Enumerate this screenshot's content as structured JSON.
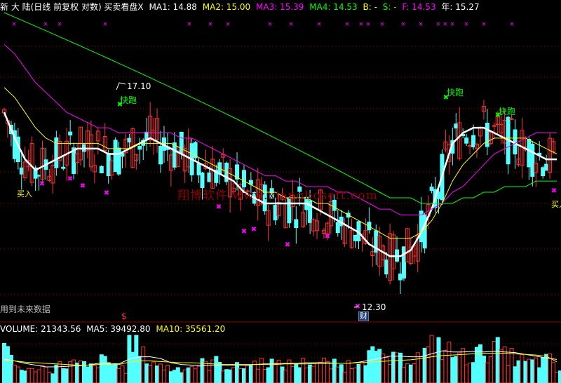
{
  "header": {
    "title": "新 大 陆(日线 前复权 对数) 买卖看盘X",
    "ma1": "MA1: 14.88",
    "ma2": "MA2: 15.00",
    "ma3": "MA3: 15.39",
    "ma4": "MA4: 14.53",
    "b": "B: -",
    "s": "S: -",
    "f": "F: 14.53",
    "year": "年: 15.27"
  },
  "volume_header": {
    "volume": "VOLUME: 21343.56",
    "ma5": "MA5: 39492.80",
    "ma10": "MA10: 35561.20"
  },
  "annotations": {
    "high_price": "17.10",
    "low_price": "12.30",
    "run_label": "快跑",
    "buy_label": "买入",
    "future_data": "用到未来数据",
    "dollar": "$",
    "cai": "财",
    "watermark": "翔博软件 www.xiangbosoft.com"
  },
  "colors": {
    "background": "#000000",
    "up_candle": "#ff3232",
    "down_candle": "#54ffff",
    "ma1": "#ffffff",
    "ma2": "#ffff00",
    "ma3": "#ff00ff",
    "ma4": "#00ff00",
    "grid": "#8b0000",
    "markers": "#ff00ff",
    "run_label": "#00ff00",
    "buy_label": "#ffff00"
  },
  "chart_data": [
    {
      "type": "candlestick",
      "scale": "log",
      "ylim": [
        12.2,
        17.9
      ],
      "series": [
        {
          "name": "MA1",
          "values": [
            15.8,
            15.3,
            14.9,
            14.7,
            14.8,
            14.9,
            15.0,
            15.1,
            15.1,
            15.1,
            15.0,
            15.0,
            15.1,
            15.2,
            15.3,
            15.2,
            15.1,
            15.0,
            14.9,
            14.8,
            14.7,
            14.6,
            14.5,
            14.3,
            14.2,
            14.1,
            14.1,
            14.1,
            14.1,
            14.1,
            14.0,
            13.9,
            13.8,
            13.7,
            13.6,
            13.4,
            13.3,
            13.2,
            13.2,
            13.3,
            13.6,
            14.0,
            14.6,
            15.2,
            15.4,
            15.5,
            15.5,
            15.4,
            15.3,
            15.2,
            15.1,
            15.0,
            14.9,
            14.9
          ]
        },
        {
          "name": "MA2",
          "values": [
            16.3,
            16.1,
            15.8,
            15.5,
            15.3,
            15.2,
            15.2,
            15.2,
            15.2,
            15.2,
            15.1,
            15.1,
            15.1,
            15.2,
            15.2,
            15.2,
            15.2,
            15.1,
            15.0,
            14.9,
            14.8,
            14.7,
            14.6,
            14.5,
            14.4,
            14.3,
            14.3,
            14.2,
            14.2,
            14.2,
            14.1,
            14.1,
            14.0,
            13.9,
            13.8,
            13.7,
            13.6,
            13.5,
            13.5,
            13.5,
            13.6,
            13.8,
            14.1,
            14.5,
            14.8,
            15.0,
            15.2,
            15.3,
            15.3,
            15.3,
            15.3,
            15.2,
            15.1,
            15.0
          ]
        },
        {
          "name": "MA3",
          "values": [
            17.2,
            17.0,
            16.7,
            16.4,
            16.2,
            16.0,
            15.8,
            15.7,
            15.6,
            15.5,
            15.5,
            15.4,
            15.4,
            15.4,
            15.4,
            15.4,
            15.4,
            15.3,
            15.3,
            15.2,
            15.1,
            15.0,
            14.9,
            14.8,
            14.7,
            14.6,
            14.6,
            14.5,
            14.5,
            14.4,
            14.4,
            14.4,
            14.3,
            14.3,
            14.2,
            14.1,
            14.0,
            14.0,
            13.9,
            13.9,
            13.9,
            14.0,
            14.1,
            14.3,
            14.4,
            14.6,
            14.8,
            15.0,
            15.1,
            15.2,
            15.3,
            15.4,
            15.4,
            15.4
          ]
        },
        {
          "name": "MA4",
          "values": [
            17.9,
            17.8,
            17.7,
            17.6,
            17.5,
            17.4,
            17.3,
            17.2,
            17.1,
            17.0,
            16.9,
            16.8,
            16.7,
            16.6,
            16.5,
            16.4,
            16.3,
            16.2,
            16.1,
            16.0,
            15.9,
            15.8,
            15.7,
            15.6,
            15.5,
            15.4,
            15.3,
            15.2,
            15.1,
            15.0,
            14.9,
            14.8,
            14.7,
            14.6,
            14.5,
            14.4,
            14.3,
            14.2,
            14.2,
            14.2,
            14.1,
            14.1,
            14.1,
            14.1,
            14.2,
            14.2,
            14.3,
            14.3,
            14.4,
            14.4,
            14.4,
            14.5,
            14.5,
            14.5
          ]
        }
      ]
    },
    {
      "type": "bar",
      "title": "VOLUME",
      "series": [
        {
          "name": "VOLUME",
          "values": [
            52000,
            30000,
            21000,
            28000,
            25000,
            30000,
            34000,
            31000,
            27000,
            38000,
            33000,
            26000,
            75000,
            48000,
            36000,
            28000,
            25000,
            28000,
            30000,
            33000,
            36000,
            30000,
            27000,
            31000,
            35000,
            37000,
            30000,
            32000,
            34000,
            36000,
            35000,
            31000,
            29000,
            33000,
            48000,
            50000,
            44000,
            40000,
            42000,
            45000,
            52000,
            68000,
            56000,
            50000,
            47000,
            51000,
            56000,
            60000,
            47000,
            39000,
            35000,
            37000,
            39000,
            21343
          ]
        },
        {
          "name": "MA5",
          "values": [
            40000,
            37000,
            33000,
            30000,
            27000,
            27000,
            28000,
            29000,
            30000,
            33000,
            33000,
            32000,
            40000,
            44000,
            44000,
            41000,
            34000,
            31000,
            30000,
            29000,
            30000,
            30000,
            30000,
            30000,
            31000,
            32000,
            32000,
            33000,
            33000,
            34000,
            34000,
            34000,
            33000,
            33000,
            35000,
            38000,
            41000,
            45000,
            45000,
            44000,
            44000,
            49000,
            54000,
            52000,
            52000,
            53000,
            52000,
            53000,
            52000,
            51000,
            48000,
            45000,
            42000,
            39493
          ]
        },
        {
          "name": "MA10",
          "values": [
            38000,
            37000,
            35000,
            34000,
            33000,
            32000,
            31000,
            30000,
            30000,
            31000,
            31000,
            31000,
            35000,
            37000,
            37000,
            36000,
            35000,
            34000,
            34000,
            33000,
            32000,
            31000,
            31000,
            31000,
            31000,
            31000,
            31000,
            32000,
            32000,
            32000,
            33000,
            33000,
            33000,
            33000,
            34000,
            35000,
            36000,
            37000,
            38000,
            39000,
            41000,
            44000,
            46000,
            47000,
            48000,
            49000,
            50000,
            50000,
            50000,
            49000,
            48000,
            47000,
            45000,
            35561
          ]
        }
      ]
    }
  ]
}
